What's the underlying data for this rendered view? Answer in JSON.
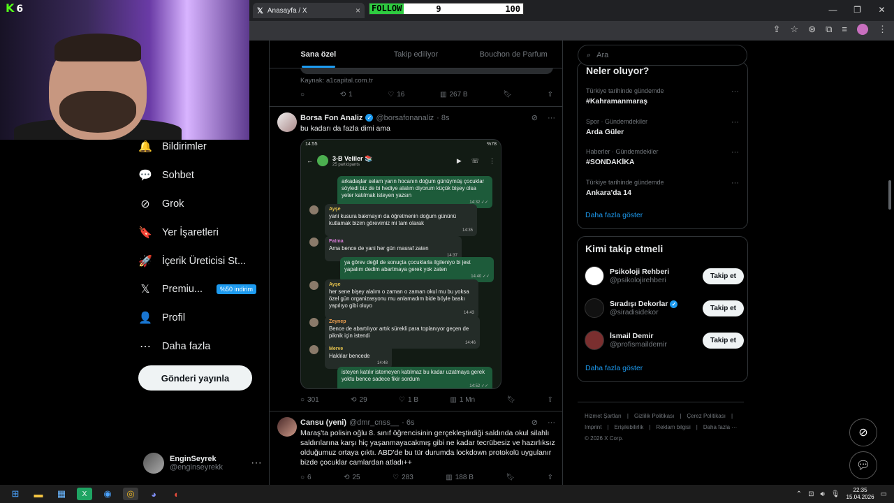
{
  "browser": {
    "tab_title": "Anasayfa / X",
    "tab_icon": "x-logo-icon",
    "close_glyph": "×",
    "window_controls": [
      "—",
      "❐",
      "✕"
    ]
  },
  "overlay": {
    "kick_count": "6",
    "follow_label": "FOLLOW",
    "follow_count": "9",
    "follow_target": "100",
    "follow_progress": 0.09
  },
  "nav": {
    "items": [
      {
        "label": "Bildirimler",
        "icon": "bell-icon",
        "glyph": "🔔"
      },
      {
        "label": "Sohbet",
        "icon": "chat-icon",
        "glyph": "💬"
      },
      {
        "label": "Grok",
        "icon": "grok-icon",
        "glyph": "⊘"
      },
      {
        "label": "Yer İşaretleri",
        "icon": "bookmark-icon",
        "glyph": "🔖"
      },
      {
        "label": "İçerik Üreticisi St...",
        "icon": "rocket-icon",
        "glyph": "🚀"
      },
      {
        "label": "Premiu...",
        "icon": "x-premium-icon",
        "glyph": "𝕏",
        "badge": "%50 indirim"
      },
      {
        "label": "Profil",
        "icon": "profile-icon",
        "glyph": "👤"
      },
      {
        "label": "Daha fazla",
        "icon": "more-circle-icon",
        "glyph": "⋯"
      }
    ],
    "post_button": "Gönderi yayınla",
    "account": {
      "name": "EnginSeyrek",
      "handle": "@enginseyrekk"
    }
  },
  "timeline": {
    "tabs": [
      "Sana özel",
      "Takip ediliyor",
      "Bouchon de Parfum"
    ],
    "prev_tweet": {
      "source": "Kaynak: a1capital.com.tr",
      "retweets": "1",
      "likes": "16",
      "views": "267 B"
    },
    "tweet1": {
      "name": "Borsa Fon Analiz",
      "handle": "@borsafonanaliz",
      "time": "· 8s",
      "text": "bu kadarı da fazla dimi ama",
      "replies": "301",
      "retweets": "29",
      "likes": "1 B",
      "views": "1 Mn",
      "chat": {
        "status_left": "14:55",
        "status_right": "%78",
        "group": "3-B Veliler 📚",
        "participants": "25 participants",
        "messages": [
          {
            "dir": "out",
            "text": "arkadaşlar selam yarın hocanın doğum günüymüş çocuklar söyledi biz de bi hediye alalım diyorum küçük bişey olsa yeter katılmak isteyen yazsın",
            "time": "14:32 ✓✓"
          },
          {
            "dir": "in",
            "who": "Ayşe",
            "text": "yani kusura bakmayın da öğretmenin doğum gününü kutlamak bizim görevimiz mi tam olarak",
            "time": "14:35"
          },
          {
            "dir": "in",
            "who": "Fatma",
            "text": "Ama bence de yani her gün masraf zaten",
            "time": "14:37"
          },
          {
            "dir": "out",
            "text": "ya görev değil de sonuçta çocuklarla ilgileniyo bi jest yapalım dedim abartmaya gerek yok zaten",
            "time": "14:40 ✓✓"
          },
          {
            "dir": "in",
            "who": "Ayşe",
            "text": "her sene bişey alalım o zaman o zaman okul mu bu yoksa özel gün organizasyonu mu anlamadım bide böyle baskı yapılıyo gibi oluyo",
            "time": "14:43"
          },
          {
            "dir": "in",
            "who": "Zeynep",
            "text": "Bence de abartılıyor artık sürekli para toplanıyor geçen de piknik için istendi",
            "time": "14:46"
          },
          {
            "dir": "in",
            "who": "Merve",
            "text": "Haklılar bencede",
            "time": "14:48"
          },
          {
            "dir": "out",
            "text": "isteyen katılır istemeyen katılmaz bu kadar uzatmaya gerek yoktu bence sadece fikir sordum",
            "time": "14:52 ✓✓"
          }
        ]
      }
    },
    "tweet2": {
      "name": "Cansu (yeni)",
      "handle": "@dmr_cnss__",
      "time": "· 6s",
      "text": "Maraş'ta polisin oğlu 8. sınıf öğrencisinin gerçekleştirdiği saldında okul silahlı saldırılarına karşı hiç yaşanmayacakmış gibi ne kadar tecrübesiz ve hazırlıksız olduğumuz ortaya çıktı. ABD'de bu tür durumda lockdown protokolü uygulanır bizde çocuklar camlardan atladı++",
      "replies": "6",
      "retweets": "25",
      "likes": "283",
      "views": "188 B"
    }
  },
  "sidebar": {
    "search_placeholder": "Ara",
    "trends_title": "Neler oluyor?",
    "trends": [
      {
        "category": "Türkiye tarihinde gündemde",
        "title": "#Kahramanmaraş"
      },
      {
        "category": "Spor · Gündemdekiler",
        "title": "Arda Güler"
      },
      {
        "category": "Haberler · Gündemdekiler",
        "title": "#SONDAKİKA"
      },
      {
        "category": "Türkiye tarihinde gündemde",
        "title": "Ankara'da 14"
      }
    ],
    "show_more": "Daha fazla göster",
    "who_title": "Kimi takip etmeli",
    "who": [
      {
        "name": "Psikoloji Rehberi",
        "handle": "@psikolojirehberi",
        "verified": false,
        "color": "#ffffff"
      },
      {
        "name": "Sıradışı Dekorlar",
        "handle": "@siradisidekor",
        "verified": true,
        "color": "#111111"
      },
      {
        "name": "İsmail Demir",
        "handle": "@profismaildemir",
        "verified": false,
        "color": "#7a2f2f"
      }
    ],
    "follow_label": "Takip et",
    "footer": [
      "Hizmet Şartları",
      "|",
      "Gizlilik Politikası",
      "|",
      "Çerez Politikası",
      "|",
      "Imprint",
      "|",
      "Erişilebilirlik",
      "|",
      "Reklam bilgisi",
      "|",
      "Daha fazla ···",
      "© 2026 X Corp."
    ]
  },
  "taskbar": {
    "time": "22:35",
    "date": "15.04.2026"
  },
  "colors": {
    "accent": "#1d9bf0",
    "bg": "#000000",
    "border": "#2f3336",
    "muted": "#71767b"
  }
}
